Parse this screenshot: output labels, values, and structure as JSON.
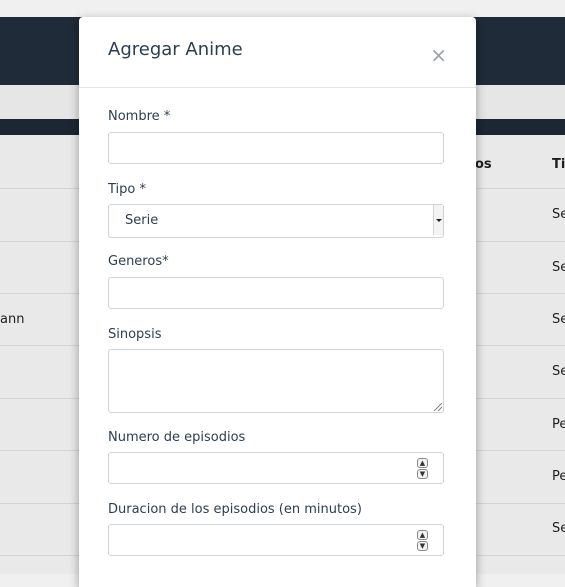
{
  "background_table": {
    "headers": [
      "os",
      "Ti"
    ],
    "rows": [
      {
        "name": "",
        "type": "Se"
      },
      {
        "name": "",
        "type": "Se"
      },
      {
        "name": "ann",
        "type": "Se"
      },
      {
        "name": "",
        "type": "Se"
      },
      {
        "name": "",
        "type": "Pe"
      },
      {
        "name": "",
        "type": "Pe"
      },
      {
        "name": "",
        "type": "Se"
      }
    ]
  },
  "modal": {
    "title": "Agregar Anime",
    "close_glyph": "×",
    "fields": {
      "nombre": {
        "label": "Nombre *",
        "value": ""
      },
      "tipo": {
        "label": "Tipo *",
        "selected": "Serie"
      },
      "generos": {
        "label": "Generos*",
        "value": ""
      },
      "sinopsis": {
        "label": "Sinopsis",
        "value": ""
      },
      "episodios": {
        "label": "Numero de episodios",
        "value": ""
      },
      "duracion": {
        "label": "Duracion de los episodios (en minutos)",
        "value": ""
      }
    }
  }
}
